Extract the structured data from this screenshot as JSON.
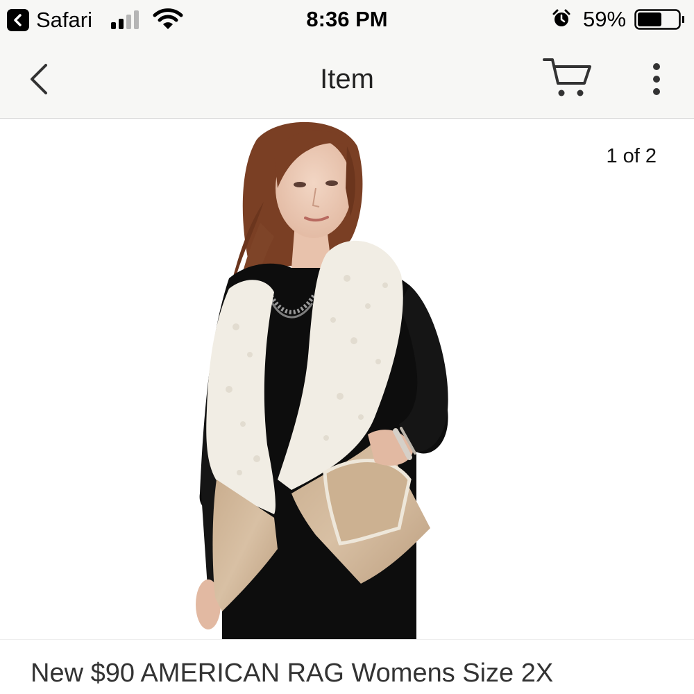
{
  "status_bar": {
    "back_app_label": "Safari",
    "time": "8:36 PM",
    "battery_percent": "59%",
    "battery_level": 0.59,
    "signal_bars": 2,
    "icons": [
      "back-chevron-icon",
      "cellular-signal-icon",
      "wifi-icon",
      "alarm-icon",
      "battery-icon"
    ]
  },
  "nav": {
    "title": "Item",
    "icons": [
      "back-chevron-icon",
      "cart-icon",
      "more-vertical-icon"
    ]
  },
  "gallery": {
    "counter": "1 of 2",
    "current": 1,
    "total": 2
  },
  "product": {
    "title": "New $90 AMERICAN RAG Womens Size 2X"
  },
  "colors": {
    "bar_background": "#f7f7f5",
    "text_primary": "#222222",
    "product_title": "#333333"
  }
}
